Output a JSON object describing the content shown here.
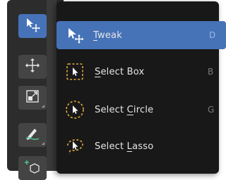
{
  "toolbar": {
    "tools": [
      {
        "name": "tweak",
        "icon": "tweak-icon",
        "active": true
      },
      {
        "name": "move",
        "icon": "move-icon",
        "active": false
      },
      {
        "name": "scale",
        "icon": "scale-icon",
        "active": false
      },
      {
        "name": "annotate",
        "icon": "annotate-icon",
        "active": false
      },
      {
        "name": "add-cube",
        "icon": "add-cube-icon",
        "active": false
      }
    ]
  },
  "menu": {
    "items": [
      {
        "label_first": "T",
        "label_rest": "weak",
        "shortcut": "D",
        "icon": "tweak-icon",
        "active": true
      },
      {
        "label_first": "S",
        "label_rest": "elect Box",
        "shortcut": "B",
        "icon": "select-box-icon",
        "active": false
      },
      {
        "label_pre": "Select ",
        "label_first": "C",
        "label_rest": "ircle",
        "shortcut": "G",
        "icon": "select-circle-icon",
        "active": false
      },
      {
        "label_pre": "Select ",
        "label_first": "L",
        "label_rest": "asso",
        "shortcut": "",
        "icon": "select-lasso-icon",
        "active": false
      }
    ]
  },
  "colors": {
    "accent": "#4672b8",
    "menu_bg": "#181818",
    "toolbar_bg": "#2c2c2c",
    "text": "#e6e6e6",
    "dashed_outline": "#e0a93a"
  }
}
